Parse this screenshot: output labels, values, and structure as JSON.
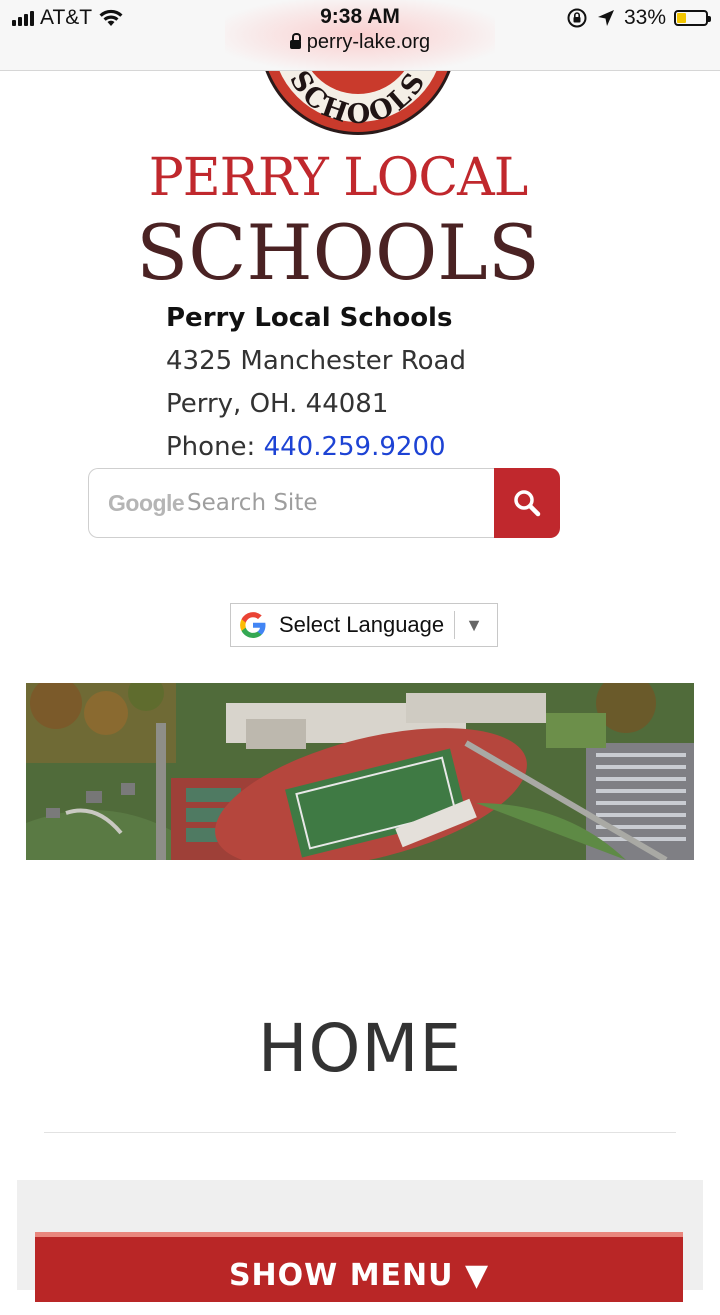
{
  "status_bar": {
    "carrier": "AT&T",
    "time": "9:38 AM",
    "url": "perry-lake.org",
    "battery": "33%",
    "battery_level": 0.33,
    "icons": [
      "signal-icon",
      "wifi-icon",
      "lock-icon",
      "orientation-lock-icon",
      "location-arrow-icon",
      "battery-icon"
    ]
  },
  "logo": {
    "seal_text": "SCHOOLS",
    "line1": "PERRY LOCAL",
    "line2": "SCHOOLS",
    "colors": {
      "red": "#c0282d",
      "brown": "#4a2223"
    }
  },
  "address": {
    "name": "Perry Local Schools",
    "street": "4325 Manchester Road",
    "city": "Perry, OH. 44081",
    "phone_label": "Phone: ",
    "phone": "440.259.9200"
  },
  "search": {
    "brand": "Google",
    "placeholder": "Search Site",
    "button_icon": "search-icon"
  },
  "language": {
    "label": "Select Language",
    "icon": "google-g-icon"
  },
  "page": {
    "title": "HOME",
    "menu_button": "SHOW MENU ▼"
  },
  "colors": {
    "accent": "#c0282d",
    "link": "#1d43d4"
  }
}
